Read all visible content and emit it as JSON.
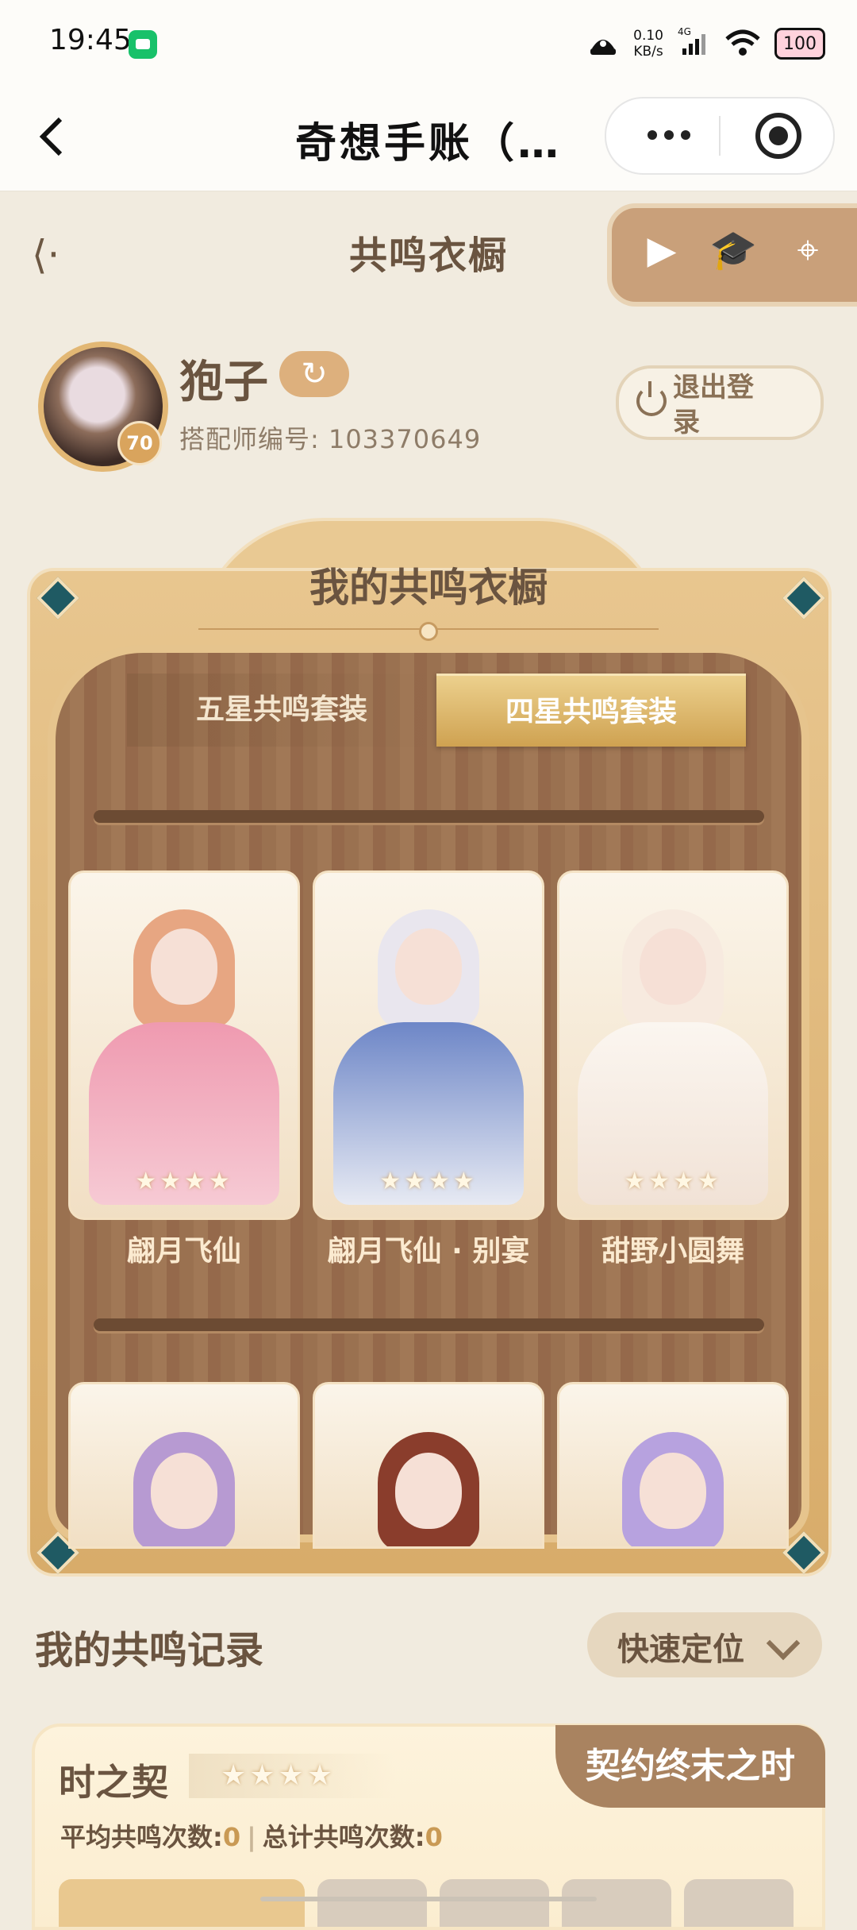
{
  "status_bar": {
    "time": "19:45",
    "net_speed_value": "0.10",
    "net_speed_unit": "KB/s",
    "signal": "4G",
    "battery": "100",
    "icons": [
      "wechat-miniprogram-icon",
      "alarm-icon",
      "signal-icon",
      "wifi-icon",
      "battery-icon"
    ]
  },
  "titlebar": {
    "title": "奇想手账（…",
    "back_icon": "chevron-left-icon",
    "more_icon": "more-dots-icon",
    "close_icon": "close-target-icon"
  },
  "page": {
    "title": "共鸣衣橱",
    "back_icon": "ornate-back-arrow-icon",
    "quick_icons": [
      "play-arrow-icon",
      "graduate-cap-icon",
      "map-pin-icon"
    ]
  },
  "profile": {
    "nickname": "狍子",
    "level": "70",
    "designer_id": "搭配师编号: 103370649",
    "logout": "退出登录",
    "switch_icon": "refresh-icon"
  },
  "wardrobe": {
    "title": "我的共鸣衣橱",
    "tabs": [
      {
        "label": "五星共鸣套装",
        "active": false
      },
      {
        "label": "四星共鸣套装",
        "active": true
      }
    ],
    "row1": [
      {
        "name": "翩月飞仙",
        "stars": "★★★★",
        "hair": "#e7a682",
        "dress": "#ef9ab0"
      },
      {
        "name": "翩月飞仙 · 别宴",
        "stars": "★★★★",
        "hair": "#e9e6ee",
        "dress": "#6d86c7"
      },
      {
        "name": "甜野小圆舞",
        "stars": "★★★★",
        "hair": "#f7eadf",
        "dress": "#fbf6f0"
      }
    ],
    "row2": [
      {
        "hair": "#b79ad2",
        "dress": "#e7ddf0"
      },
      {
        "hair": "#8a3d2c",
        "dress": "#3f4d3a"
      },
      {
        "hair": "#b7a2df",
        "dress": "#f2ecf8"
      }
    ]
  },
  "records": {
    "title": "我的共鸣记录",
    "locate_label": "快速定位",
    "card": {
      "name": "时之契",
      "stars": "★★★★",
      "tag": "契约终末之时",
      "avg_label": "平均共鸣次数:",
      "avg_value": "0",
      "total_label": "总计共鸣次数:",
      "total_value": "0"
    }
  },
  "colors": {
    "accent": "#d8ac6a",
    "text_brown": "#6a5440",
    "background": "#f1ebdf"
  }
}
